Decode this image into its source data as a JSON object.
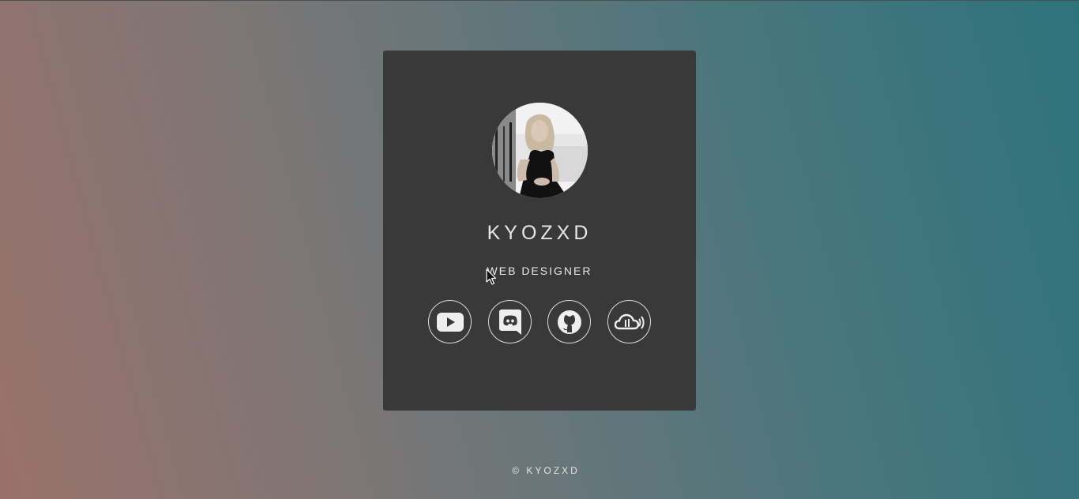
{
  "profile": {
    "name": "KYOZXD",
    "role": "WEB DESIGNER",
    "avatar_icon": "portrait-photo"
  },
  "socials": [
    {
      "name": "youtube",
      "icon": "youtube-icon"
    },
    {
      "name": "discord",
      "icon": "discord-icon"
    },
    {
      "name": "github",
      "icon": "github-icon"
    },
    {
      "name": "soundcloud",
      "icon": "soundcloud-icon"
    }
  ],
  "footer": {
    "text": "© KYOZXD"
  },
  "colors": {
    "card_bg": "#393939",
    "text": "#e6e6e6",
    "gradient_left": "#9a716a",
    "gradient_right": "#2e737c"
  }
}
